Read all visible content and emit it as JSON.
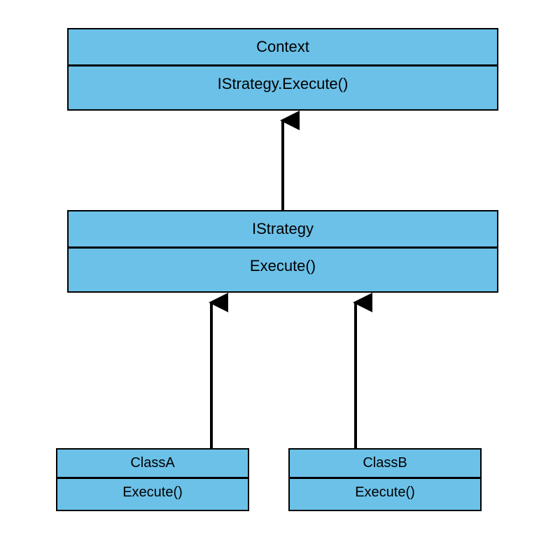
{
  "colors": {
    "box_fill": "#6cc1e8",
    "stroke": "#000000"
  },
  "boxes": {
    "context": {
      "title": "Context",
      "body": "IStrategy.Execute()"
    },
    "istrategy": {
      "title": "IStrategy",
      "body": "Execute()"
    },
    "classA": {
      "title": "ClassA",
      "body": "Execute()"
    },
    "classB": {
      "title": "ClassB",
      "body": "Execute()"
    }
  },
  "relations": [
    {
      "from": "istrategy",
      "to": "context"
    },
    {
      "from": "classA",
      "to": "istrategy"
    },
    {
      "from": "classB",
      "to": "istrategy"
    }
  ]
}
